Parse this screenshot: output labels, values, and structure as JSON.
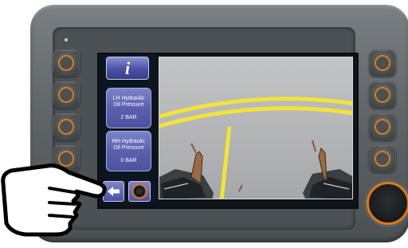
{
  "info_button": {
    "label": "i"
  },
  "tiles": [
    {
      "label_line1": "LH Hydraulic",
      "label_line2": "Oil Pressure",
      "value": "2 BAR"
    },
    {
      "label_line1": "RH Hydraulic",
      "label_line2": "Oil Pressure",
      "value": "0 BAR"
    }
  ],
  "colors": {
    "accent_orange": "#e07b12",
    "button_blue": "#5a60ae",
    "guide_line_yellow": "#f2e33a",
    "device_grey": "#5f6568"
  },
  "icons": {
    "back": "arrow-left-icon",
    "dial": "dial-icon",
    "pointer": "pointing-hand-icon"
  }
}
